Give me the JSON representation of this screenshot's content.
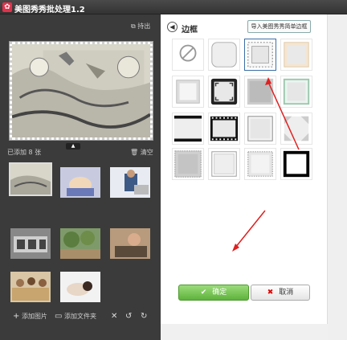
{
  "window": {
    "title": "美图秀秀批处理1.2",
    "icon": "app-logo-icon"
  },
  "left": {
    "pin_label": "持出",
    "added_count": "已添加 8 张",
    "clear_label": "清空",
    "collapse_icon": "collapse-arrow-icon",
    "thumbnails": [
      "image-1",
      "image-2",
      "image-3",
      "image-4",
      "image-5",
      "image-6",
      "image-7",
      "image-8"
    ],
    "add_image_label": "添加图片",
    "add_folder_label": "添加文件夹"
  },
  "right": {
    "panel_title": "边框",
    "import_button": "导入美图秀秀简单边框",
    "frames": [
      "no-frame",
      "rounded-frame",
      "dashed-frame",
      "beige-frame",
      "shadow-frame",
      "corner-frame",
      "gray-frame",
      "green-frame",
      "line-frame",
      "film-frame",
      "thin-frame",
      "diamond-frame",
      "zigzag-frame",
      "double-frame",
      "stamp-frame",
      "bold-frame"
    ],
    "confirm_label": "确定",
    "cancel_label": "取消",
    "colors": {
      "confirm": "#5eb23c",
      "cancel_icon": "#dd0000",
      "arrow": "#e02020"
    }
  }
}
